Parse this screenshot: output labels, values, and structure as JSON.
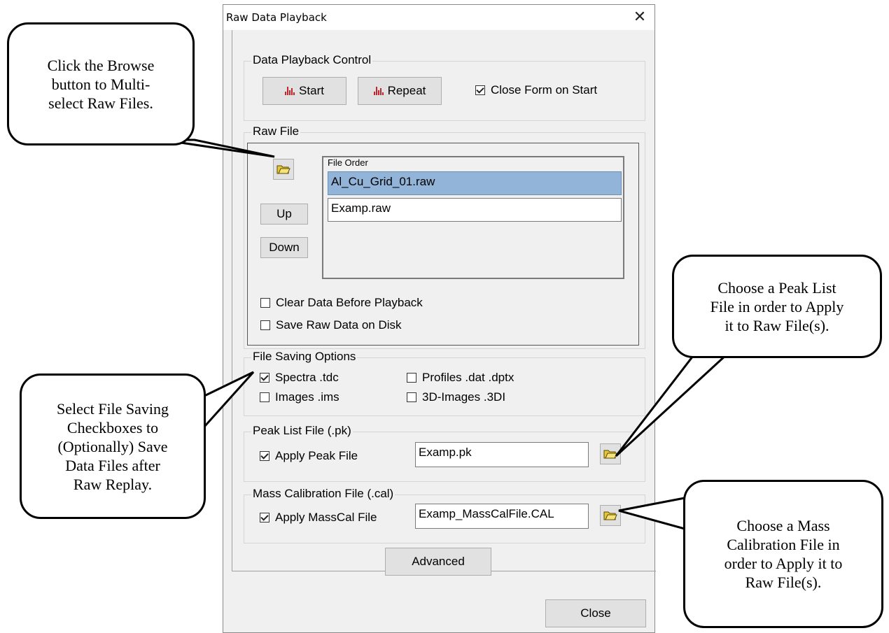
{
  "window": {
    "title": "Raw Data Playback",
    "close_glyph": "✕"
  },
  "playback": {
    "group_label": "Data Playback Control",
    "start_label": "Start",
    "repeat_label": "Repeat",
    "close_on_start_label": "Close Form on Start",
    "close_on_start_checked": true
  },
  "raw_file": {
    "group_label": "Raw File",
    "browse_icon": "open-folder-icon",
    "up_label": "Up",
    "down_label": "Down",
    "list_header": "File Order",
    "files": [
      {
        "name": "Al_Cu_Grid_01.raw",
        "selected": true
      },
      {
        "name": "Examp.raw",
        "selected": false
      }
    ],
    "clear_data_label": "Clear Data Before Playback",
    "clear_data_checked": false,
    "save_raw_label": "Save Raw Data on Disk",
    "save_raw_checked": false
  },
  "saving": {
    "group_label": "File Saving Options",
    "spectra_label": "Spectra .tdc",
    "spectra_checked": true,
    "profiles_label": "Profiles .dat .dptx",
    "profiles_checked": false,
    "images_label": "Images .ims",
    "images_checked": false,
    "images3d_label": "3D-Images .3DI",
    "images3d_checked": false
  },
  "peak": {
    "group_label": "Peak List File (.pk)",
    "apply_label": "Apply Peak File",
    "apply_checked": true,
    "file_value": "Examp.pk"
  },
  "masscal": {
    "group_label": "Mass Calibration File (.cal)",
    "apply_label": "Apply MassCal File",
    "apply_checked": true,
    "file_value": "Examp_MassCalFile.CAL"
  },
  "advanced_label": "Advanced",
  "close_label": "Close",
  "callouts": {
    "browse": [
      "Click the Browse",
      "button to Multi-",
      "select Raw Files."
    ],
    "saving": [
      "Select File Saving",
      "Checkboxes to",
      "(Optionally) Save",
      "Data Files after",
      "Raw Replay."
    ],
    "peak": [
      "Choose a Peak List",
      "File in order to Apply",
      "it to Raw File(s)."
    ],
    "masscal": [
      "Choose a Mass",
      "Calibration File in",
      "order to Apply it to",
      "Raw File(s)."
    ]
  },
  "colors": {
    "accent_bar": "#c0262d",
    "selection": "#91b4d8",
    "folder": "#e8c53a"
  }
}
